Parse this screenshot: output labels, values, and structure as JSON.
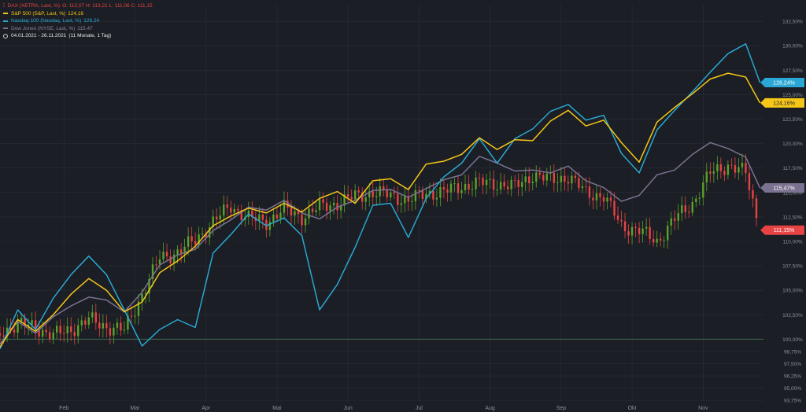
{
  "legend": {
    "dax": {
      "text": "DAX (XETRA, Last, %)",
      "ohlc": "O: 112,07  H: 113,21  L: 111,06  C: 111,15",
      "color": "#e84343",
      "icon": "candlestick-glyph"
    },
    "sp500": {
      "text": "S&P 500 (S&P, Last, %)",
      "value": "124,16",
      "color": "#f5c518"
    },
    "nasdaq": {
      "text": "Nasdaq-100 (Nasdaq, Last, %)",
      "value": "126,24",
      "color": "#2aa7d4"
    },
    "dow": {
      "text": "Dow Jones (NYSE, Last, %)",
      "value": "115,47",
      "color": "#7b7190"
    },
    "range": {
      "text": "04.01.2021 - 26.11.2021",
      "period": "(11 Monate, 1 Tag)",
      "icon": "clock-icon"
    }
  },
  "colors": {
    "background": "#1b1e24",
    "grid": "#2b2f37",
    "baseline": "#3f6e4e",
    "up": "#5aa32a",
    "down": "#e84343",
    "axis_text": "#8c919a"
  },
  "chart_data": {
    "type": "line",
    "title": "",
    "xlabel": "",
    "ylabel": "",
    "x_ticks": [
      "Feb",
      "Mar",
      "Apr",
      "Mai",
      "Jun",
      "Jul",
      "Aug",
      "Sep",
      "Okt",
      "Nov"
    ],
    "x_tick_months": [
      1,
      2,
      3,
      4,
      5,
      6,
      7,
      8,
      9,
      10
    ],
    "x_range_months": [
      0.1,
      10.85
    ],
    "y_ticks": [
      "132,50%",
      "130,00%",
      "127,50%",
      "125,00%",
      "122,50%",
      "120,00%",
      "117,50%",
      "115,00%",
      "112,50%",
      "110,00%",
      "107,50%",
      "105,00%",
      "102,50%",
      "100,00%",
      "98,75%",
      "97,50%",
      "96,25%",
      "95,00%",
      "93,75%"
    ],
    "y_tick_values": [
      132.5,
      130,
      127.5,
      125,
      122.5,
      120,
      117.5,
      115,
      112.5,
      110,
      107.5,
      105,
      102.5,
      100,
      98.75,
      97.5,
      96.25,
      95,
      93.75
    ],
    "ylim": [
      93.6,
      134.2
    ],
    "baseline": 100,
    "grid": true,
    "legend_position": "top-left",
    "series": [
      {
        "name": "S&P 500 (S&P, Last, %)",
        "key": "sp500",
        "color": "#f5c518",
        "label": "124,16%",
        "x": [
          0.1,
          0.35,
          0.6,
          0.85,
          1.1,
          1.35,
          1.6,
          1.85,
          2.1,
          2.35,
          2.6,
          2.85,
          3.1,
          3.35,
          3.6,
          3.85,
          4.1,
          4.35,
          4.6,
          4.85,
          5.1,
          5.35,
          5.6,
          5.85,
          6.1,
          6.35,
          6.6,
          6.85,
          7.1,
          7.35,
          7.6,
          7.85,
          8.1,
          8.35,
          8.6,
          8.85,
          9.1,
          9.35,
          9.6,
          9.85,
          10.1,
          10.35,
          10.6,
          10.8
        ],
        "y": [
          99.2,
          102.0,
          100.8,
          102.5,
          104.6,
          106.2,
          105.0,
          102.8,
          103.8,
          106.8,
          108.0,
          109.5,
          111.6,
          112.6,
          113.4,
          112.9,
          113.9,
          113.0,
          114.4,
          115.1,
          113.9,
          116.2,
          116.4,
          115.3,
          117.9,
          118.2,
          118.9,
          120.6,
          119.4,
          120.4,
          120.3,
          122.3,
          123.4,
          121.8,
          122.4,
          120.1,
          118.1,
          122.2,
          123.7,
          125.1,
          126.6,
          127.2,
          126.8,
          124.16
        ]
      },
      {
        "name": "Nasdaq-100 (Nasdaq, Last, %)",
        "key": "nasdaq",
        "color": "#2aa7d4",
        "label": "126,24%",
        "x": [
          0.1,
          0.35,
          0.6,
          0.85,
          1.1,
          1.35,
          1.6,
          1.85,
          2.1,
          2.35,
          2.6,
          2.85,
          3.1,
          3.35,
          3.6,
          3.85,
          4.1,
          4.35,
          4.6,
          4.85,
          5.1,
          5.35,
          5.6,
          5.85,
          6.1,
          6.35,
          6.6,
          6.85,
          7.1,
          7.35,
          7.6,
          7.85,
          8.1,
          8.35,
          8.6,
          8.85,
          9.1,
          9.35,
          9.6,
          9.85,
          10.1,
          10.35,
          10.6,
          10.8
        ],
        "y": [
          99.0,
          103.0,
          101.0,
          104.2,
          106.6,
          108.5,
          106.6,
          103.0,
          99.3,
          101.0,
          102.0,
          101.2,
          108.8,
          110.7,
          112.8,
          111.6,
          112.4,
          110.6,
          103.0,
          105.6,
          109.4,
          113.7,
          113.9,
          110.4,
          114.4,
          116.6,
          118.0,
          120.5,
          118.0,
          120.5,
          121.5,
          123.3,
          124.0,
          122.4,
          122.9,
          119.0,
          117.0,
          121.4,
          123.4,
          125.3,
          127.3,
          129.2,
          130.2,
          126.24
        ]
      },
      {
        "name": "Dow Jones (NYSE, Last, %)",
        "key": "dow",
        "color": "#7b7190",
        "label": "115,47%",
        "x": [
          0.1,
          0.35,
          0.6,
          0.85,
          1.1,
          1.35,
          1.6,
          1.85,
          2.1,
          2.35,
          2.6,
          2.85,
          3.1,
          3.35,
          3.6,
          3.85,
          4.1,
          4.35,
          4.6,
          4.85,
          5.1,
          5.35,
          5.6,
          5.85,
          6.1,
          6.35,
          6.6,
          6.85,
          7.1,
          7.35,
          7.6,
          7.85,
          8.1,
          8.35,
          8.6,
          8.85,
          9.1,
          9.35,
          9.6,
          9.85,
          10.1,
          10.35,
          10.6,
          10.8
        ],
        "y": [
          99.5,
          101.8,
          100.6,
          102.3,
          103.4,
          104.3,
          104.0,
          102.8,
          104.8,
          107.6,
          108.6,
          109.2,
          111.1,
          112.2,
          113.5,
          113.2,
          114.2,
          112.9,
          112.3,
          113.5,
          114.2,
          115.2,
          115.3,
          114.5,
          115.4,
          116.3,
          116.8,
          118.7,
          118.0,
          117.2,
          117.3,
          117.0,
          117.7,
          116.2,
          115.5,
          114.1,
          114.7,
          116.8,
          117.3,
          118.9,
          120.1,
          119.5,
          118.6,
          115.47
        ]
      },
      {
        "name": "DAX (XETRA, Last, %)",
        "key": "dax",
        "color": "#e84343",
        "label": "111,15%",
        "x": [
          0.1,
          0.35,
          0.6,
          0.85,
          1.1,
          1.35,
          1.6,
          1.85,
          2.1,
          2.35,
          2.6,
          2.85,
          3.1,
          3.35,
          3.6,
          3.85,
          4.1,
          4.35,
          4.6,
          4.85,
          5.1,
          5.35,
          5.6,
          5.85,
          6.1,
          6.35,
          6.6,
          6.85,
          7.1,
          7.35,
          7.6,
          7.85,
          8.1,
          8.35,
          8.6,
          8.85,
          9.1,
          9.35,
          9.6,
          9.85,
          10.1,
          10.35,
          10.6,
          10.8
        ],
        "y": [
          100.6,
          101.6,
          101.2,
          100.4,
          101.0,
          102.0,
          101.3,
          100.9,
          104.6,
          108.3,
          108.9,
          110.1,
          112.0,
          113.6,
          112.4,
          112.0,
          113.3,
          112.5,
          113.5,
          113.9,
          114.6,
          115.0,
          114.7,
          114.2,
          114.9,
          115.1,
          115.6,
          116.0,
          115.9,
          115.6,
          116.8,
          116.3,
          116.6,
          115.0,
          114.6,
          111.6,
          111.1,
          110.0,
          112.3,
          113.9,
          117.0,
          117.8,
          117.0,
          111.15
        ]
      }
    ]
  }
}
